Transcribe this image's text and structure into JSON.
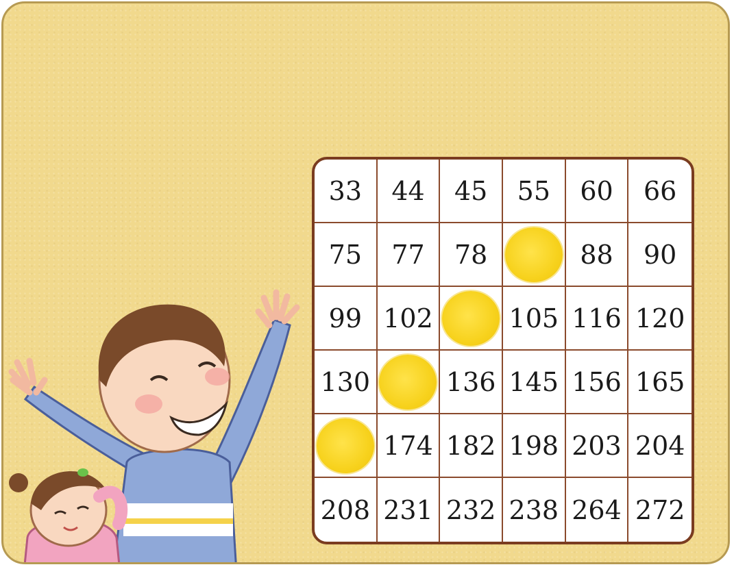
{
  "board": {
    "cells": [
      {
        "value": "33",
        "marked": false
      },
      {
        "value": "44",
        "marked": false
      },
      {
        "value": "45",
        "marked": false
      },
      {
        "value": "55",
        "marked": false
      },
      {
        "value": "60",
        "marked": false
      },
      {
        "value": "66",
        "marked": false
      },
      {
        "value": "75",
        "marked": false
      },
      {
        "value": "77",
        "marked": false
      },
      {
        "value": "78",
        "marked": false
      },
      {
        "value": "",
        "marked": true
      },
      {
        "value": "88",
        "marked": false
      },
      {
        "value": "90",
        "marked": false
      },
      {
        "value": "99",
        "marked": false
      },
      {
        "value": "102",
        "marked": false
      },
      {
        "value": "",
        "marked": true
      },
      {
        "value": "105",
        "marked": false
      },
      {
        "value": "116",
        "marked": false
      },
      {
        "value": "120",
        "marked": false
      },
      {
        "value": "130",
        "marked": false
      },
      {
        "value": "",
        "marked": true
      },
      {
        "value": "136",
        "marked": false
      },
      {
        "value": "145",
        "marked": false
      },
      {
        "value": "156",
        "marked": false
      },
      {
        "value": "165",
        "marked": false
      },
      {
        "value": "",
        "marked": true
      },
      {
        "value": "174",
        "marked": false
      },
      {
        "value": "182",
        "marked": false
      },
      {
        "value": "198",
        "marked": false
      },
      {
        "value": "203",
        "marked": false
      },
      {
        "value": "204",
        "marked": false
      },
      {
        "value": "208",
        "marked": false
      },
      {
        "value": "231",
        "marked": false
      },
      {
        "value": "232",
        "marked": false
      },
      {
        "value": "238",
        "marked": false
      },
      {
        "value": "264",
        "marked": false
      },
      {
        "value": "272",
        "marked": false
      }
    ]
  },
  "colors": {
    "background": "#f1d98d",
    "frame_border": "#b69a52",
    "grid_line": "#7a3c20",
    "marker": "#f7d21d"
  },
  "illustration": "cheering-children"
}
